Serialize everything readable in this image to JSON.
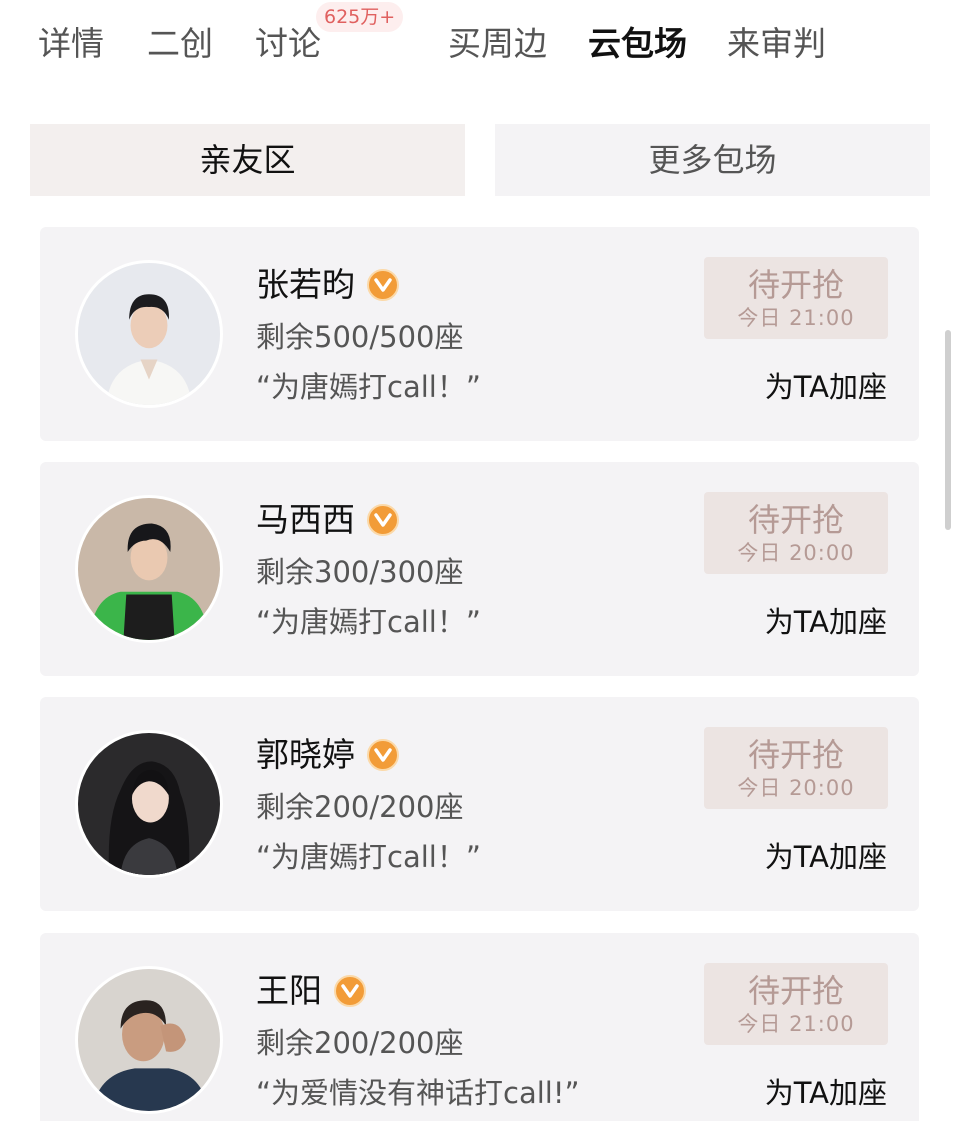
{
  "tabs": [
    {
      "label": "详情",
      "active": false
    },
    {
      "label": "二创",
      "active": false
    },
    {
      "label": "讨论",
      "active": false,
      "badge": "625万+"
    },
    {
      "label": "买周边",
      "active": false
    },
    {
      "label": "云包场",
      "active": true
    },
    {
      "label": "来审判",
      "active": false
    }
  ],
  "segments": [
    {
      "label": "亲友区",
      "active": true
    },
    {
      "label": "更多包场",
      "active": false
    }
  ],
  "cards": [
    {
      "name": "张若昀",
      "verified_icon": "v-badge-icon",
      "seats": "剩余500/500座",
      "quote": "“为唐嫣打call！”",
      "button_label": "待开抢",
      "button_time": "今日 21:00",
      "add_label": "为TA加座"
    },
    {
      "name": "马西西",
      "verified_icon": "v-badge-icon",
      "seats": "剩余300/300座",
      "quote": "“为唐嫣打call！”",
      "button_label": "待开抢",
      "button_time": "今日 20:00",
      "add_label": "为TA加座"
    },
    {
      "name": "郭晓婷",
      "verified_icon": "v-badge-icon",
      "seats": "剩余200/200座",
      "quote": "“为唐嫣打call！”",
      "button_label": "待开抢",
      "button_time": "今日 20:00",
      "add_label": "为TA加座"
    },
    {
      "name": "王阳",
      "verified_icon": "v-badge-icon",
      "seats": "剩余200/200座",
      "quote": "“为爱情没有神话打call!”",
      "button_label": "待开抢",
      "button_time": "今日 21:00",
      "add_label": "为TA加座"
    }
  ],
  "colors": {
    "accent_badge": "#f29c38",
    "button_bg": "#ece4e2",
    "button_text": "#b59a95",
    "card_bg": "#f4f3f5",
    "tab_badge_text": "#e0605f"
  }
}
